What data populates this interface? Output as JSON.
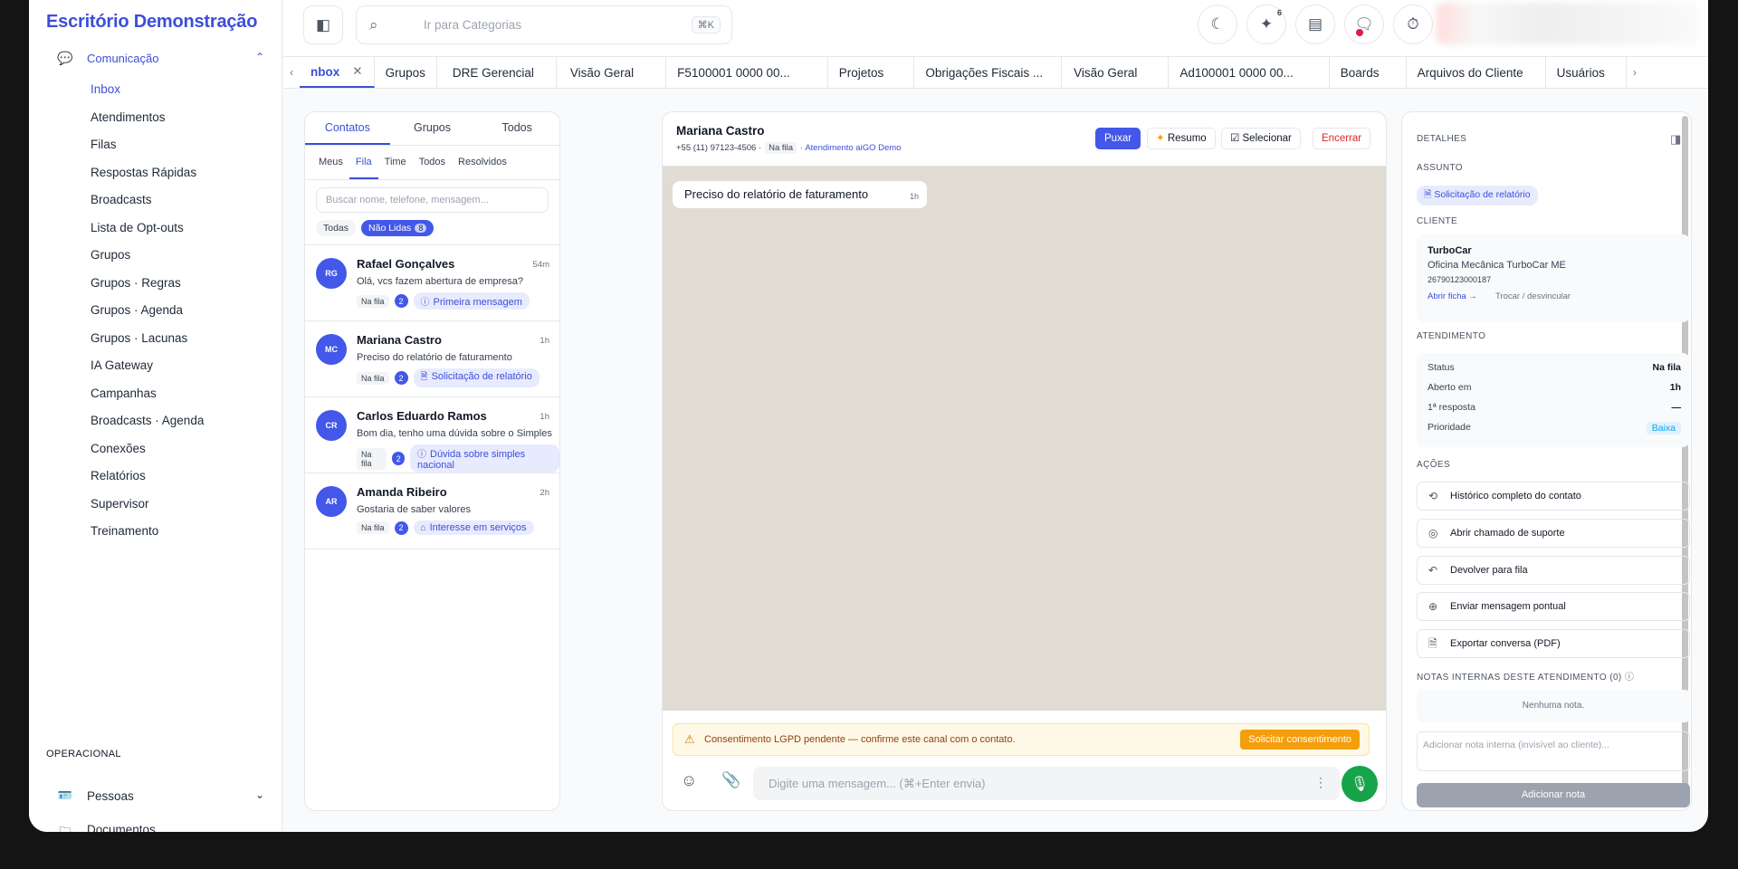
{
  "app": {
    "brand": "Escritório Demonstração"
  },
  "sidebar": {
    "section": "Comunicação",
    "items": [
      "Inbox",
      "Atendimentos",
      "Filas",
      "Respostas Rápidas",
      "Broadcasts",
      "Lista de Opt-outs",
      "Grupos",
      "Grupos · Regras",
      "Grupos · Agenda",
      "Grupos · Lacunas",
      "IA Gateway",
      "Campanhas",
      "Broadcasts · Agenda",
      "Conexões",
      "Relatórios",
      "Supervisor",
      "Treinamento"
    ],
    "group_label": "OPERACIONAL",
    "pessoas": "Pessoas",
    "documentos": "Documentos"
  },
  "topbar": {
    "search_placeholder": "Ir para Categorias",
    "search_shortcut": "⌘K",
    "ai_badge": "6"
  },
  "tabs": [
    "Inbox",
    "Grupos",
    "DRE Gerencial",
    "Visão Geral",
    "F5100001 0000 00...",
    "Projetos",
    "Obrigações Fiscais ...",
    "Visão Geral",
    "Ad100001 0000 00...",
    "Boards",
    "Arquivos do Cliente",
    "Usuários"
  ],
  "tab_active_label": "nbox",
  "inbox": {
    "main_tabs": [
      "Contatos",
      "Grupos",
      "Todos"
    ],
    "sub_tabs": [
      "Meus",
      "Fila",
      "Time",
      "Todos",
      "Resolvidos"
    ],
    "search_placeholder": "Buscar nome, telefone, mensagem...",
    "filter_all": "Todas",
    "filter_unread": "Não Lidas",
    "filter_unread_count": "8",
    "contacts": [
      {
        "initials": "RG",
        "name": "Rafael Gonçalves",
        "time": "54m",
        "message": "Olá, vcs fazem abertura de empresa?",
        "status": "Na fila",
        "count": "2",
        "subject": "Primeira mensagem",
        "subject_icon": "help-circle-icon"
      },
      {
        "initials": "MC",
        "name": "Mariana Castro",
        "time": "1h",
        "message": "Preciso do relatório de faturamento",
        "status": "Na fila",
        "count": "2",
        "subject": "Solicitação de relatório",
        "subject_icon": "document-icon"
      },
      {
        "initials": "CR",
        "name": "Carlos Eduardo Ramos",
        "time": "1h",
        "message": "Bom dia, tenho uma dúvida sobre o Simples",
        "status": "Na fila",
        "count": "2",
        "subject": "Dúvida sobre simples nacional",
        "subject_icon": "help-circle-icon"
      },
      {
        "initials": "AR",
        "name": "Amanda Ribeiro",
        "time": "2h",
        "message": "Gostaria de saber valores",
        "status": "Na fila",
        "count": "2",
        "subject": "Interesse em serviços",
        "subject_icon": "tag-icon"
      }
    ]
  },
  "chat": {
    "name": "Mariana Castro",
    "phone": "+55 (11) 97123-4506 ·",
    "status": "Na fila",
    "agent": "· Atendimento aiGO Demo",
    "btn_pull": "Puxar",
    "btn_summary": "Resumo",
    "btn_select": "Selecionar",
    "btn_close": "Encerrar",
    "message": "Preciso do relatório de faturamento",
    "message_time": "1h",
    "lgpd_text": "Consentimento LGPD pendente — confirme este canal com o contato.",
    "lgpd_button": "Solicitar consentimento",
    "composer_placeholder": "Digite uma mensagem... (⌘+Enter envia)"
  },
  "details": {
    "title": "DETALHES",
    "assunto_label": "ASSUNTO",
    "assunto_value": "Solicitação de relatório",
    "cliente_label": "CLIENTE",
    "client_name": "TurboCar",
    "client_company": "Oficina Mecânica TurboCar ME",
    "client_doc": "26790123000187",
    "open_record": "Abrir ficha →",
    "swap": "Trocar / desvincular",
    "atendimento_label": "ATENDIMENTO",
    "rows": [
      {
        "label": "Status",
        "value": "Na fila"
      },
      {
        "label": "Aberto em",
        "value": "1h"
      },
      {
        "label": "1ª resposta",
        "value": "—"
      },
      {
        "label": "Prioridade",
        "value": "Baixa"
      }
    ],
    "acoes_label": "AÇÕES",
    "actions": [
      "Histórico completo do contato",
      "Abrir chamado de suporte",
      "Devolver para fila",
      "Enviar mensagem pontual",
      "Exportar conversa (PDF)"
    ],
    "notes_label": "NOTAS INTERNAS DESTE ATENDIMENTO (0)",
    "no_notes": "Nenhuma nota.",
    "note_placeholder": "Adicionar nota interna (invisível ao cliente)...",
    "add_note": "Adicionar nota"
  }
}
